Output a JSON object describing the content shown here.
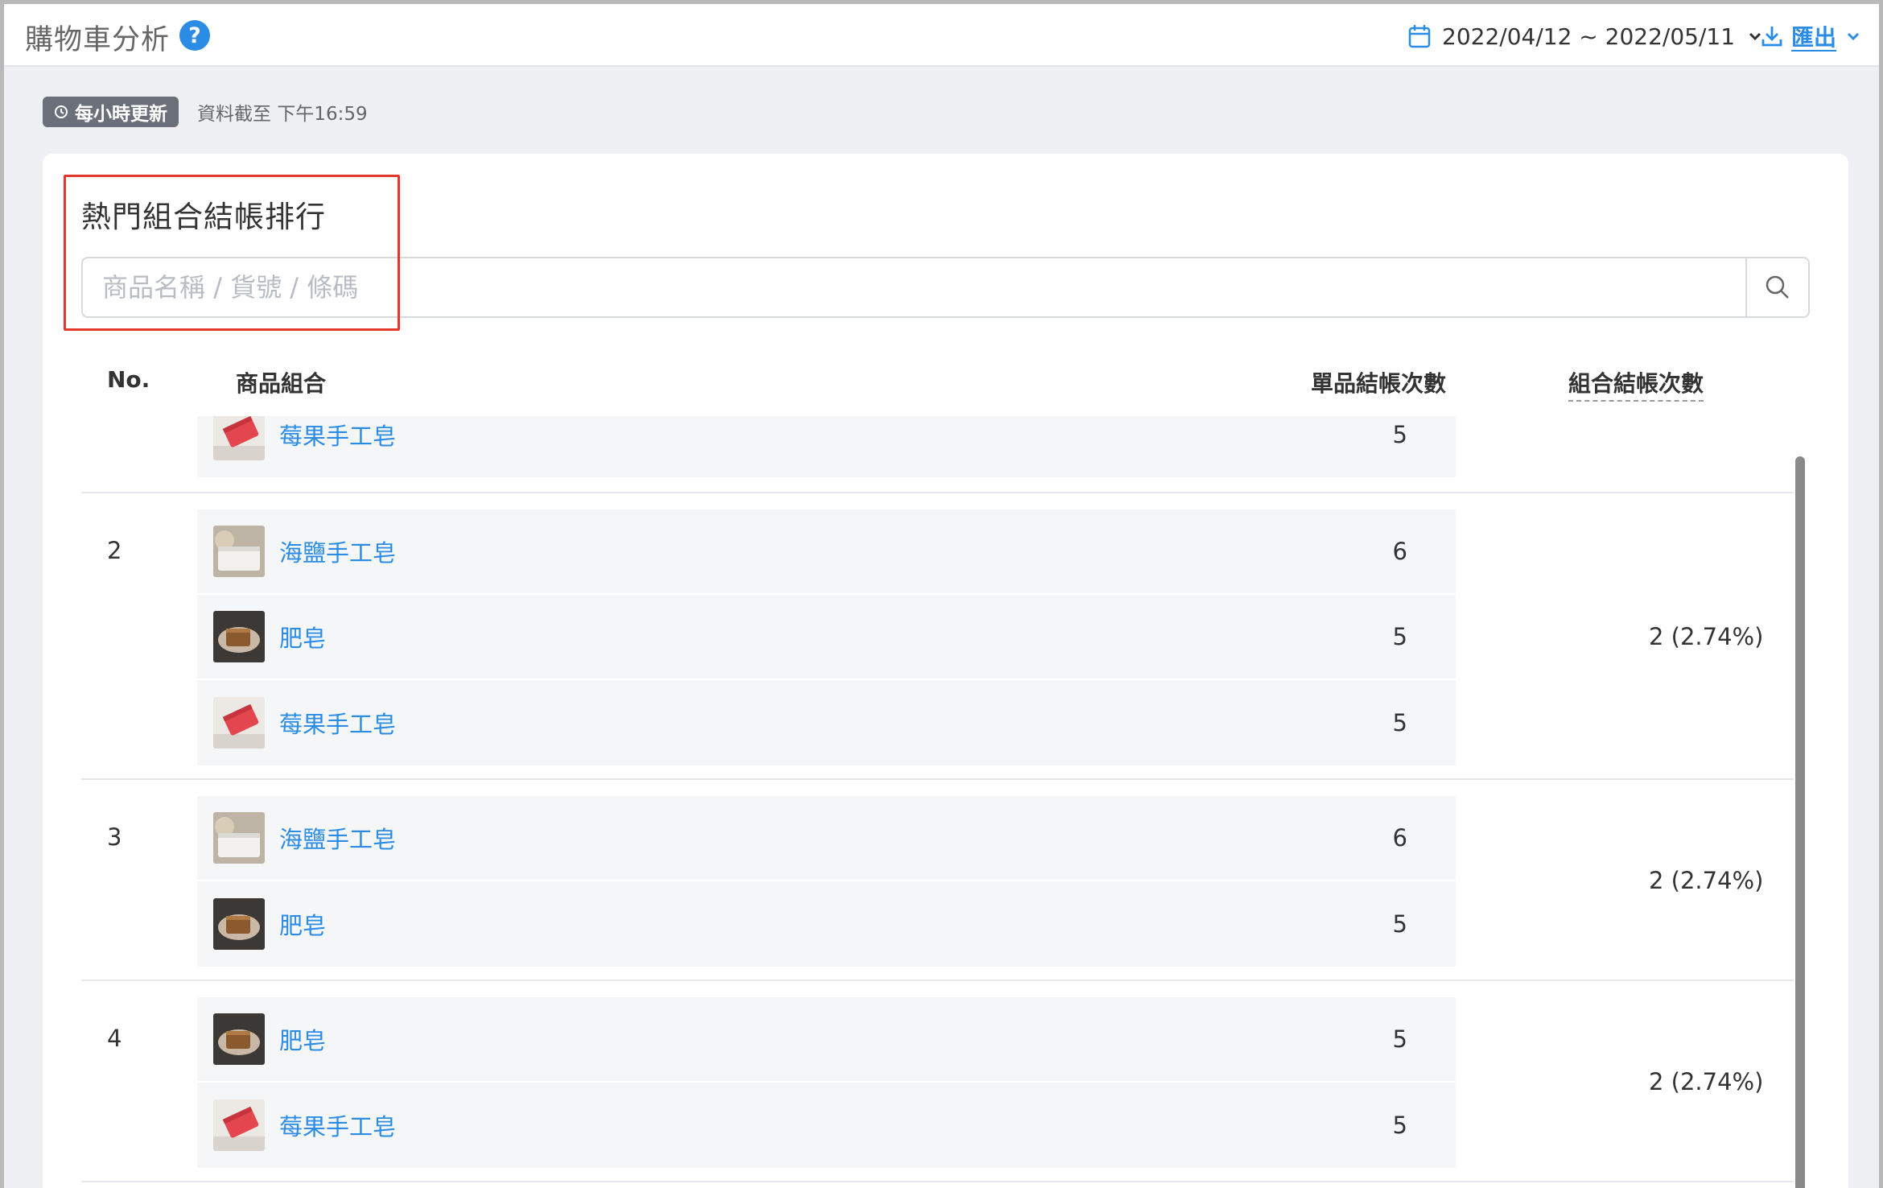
{
  "header": {
    "title": "購物車分析",
    "help_icon": "question-circle-icon",
    "date_range": "2022/04/12 ~ 2022/05/11",
    "export_label": "匯出"
  },
  "update": {
    "badge_label": "每小時更新",
    "status_text": "資料截至 下午16:59"
  },
  "card": {
    "title": "熱門組合結帳排行",
    "search_placeholder": "商品名稱 / 貨號 / 條碼"
  },
  "table": {
    "headers": {
      "no": "No.",
      "combo": "商品組合",
      "single_count": "單品結帳次數",
      "group_count": "組合結帳次數"
    },
    "rows": [
      {
        "no": "",
        "group_count": "",
        "items": [
          {
            "name": "莓果手工皂",
            "count": "5",
            "thumb": "red-soap"
          }
        ]
      },
      {
        "no": "2",
        "group_count": "2 (2.74%)",
        "items": [
          {
            "name": "海鹽手工皂",
            "count": "6",
            "thumb": "white-soap"
          },
          {
            "name": "肥皂",
            "count": "5",
            "thumb": "dark-soap"
          },
          {
            "name": "莓果手工皂",
            "count": "5",
            "thumb": "red-soap"
          }
        ]
      },
      {
        "no": "3",
        "group_count": "2 (2.74%)",
        "items": [
          {
            "name": "海鹽手工皂",
            "count": "6",
            "thumb": "white-soap"
          },
          {
            "name": "肥皂",
            "count": "5",
            "thumb": "dark-soap"
          }
        ]
      },
      {
        "no": "4",
        "group_count": "2 (2.74%)",
        "items": [
          {
            "name": "肥皂",
            "count": "5",
            "thumb": "dark-soap"
          },
          {
            "name": "莓果手工皂",
            "count": "5",
            "thumb": "red-soap"
          }
        ]
      }
    ]
  }
}
